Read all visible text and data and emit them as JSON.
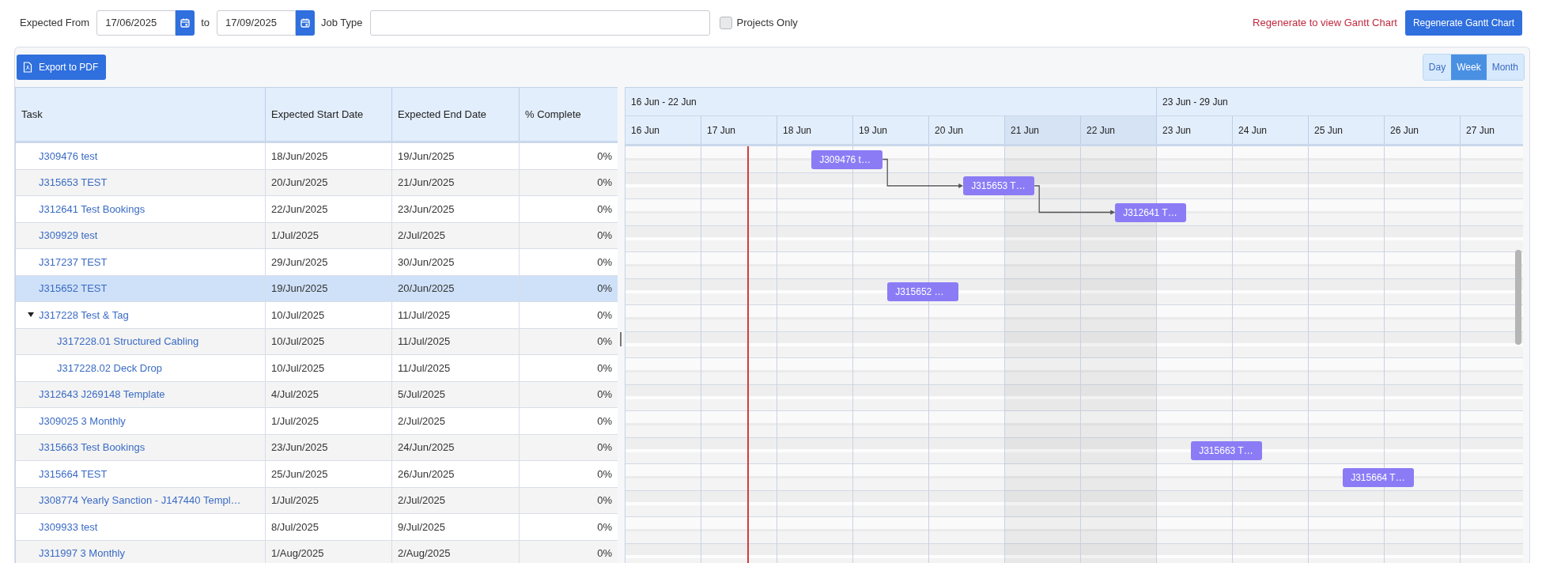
{
  "filters": {
    "expected_from": {
      "label": "Expected From",
      "value": "17/06/2025"
    },
    "to": {
      "label": "to",
      "value": "17/09/2025"
    },
    "job_type": {
      "label": "Job Type"
    },
    "projects_only": {
      "label": "Projects Only",
      "checked": false
    },
    "notice": "Regenerate to view Gantt Chart",
    "regenerate_button": "Regenerate Gantt Chart"
  },
  "toolbar": {
    "export_button": "Export to PDF",
    "scale_tabs": [
      {
        "label": "Day",
        "selected": false
      },
      {
        "label": "Week",
        "selected": true
      },
      {
        "label": "Month",
        "selected": false
      }
    ]
  },
  "table": {
    "columns": [
      "Task",
      "Expected Start Date",
      "Expected End Date",
      "% Complete"
    ]
  },
  "tasks": [
    {
      "name": "J309476 test",
      "start": "18/Jun/2025",
      "end": "19/Jun/2025",
      "complete": "0%",
      "selected": false,
      "bar": "J309476 t…"
    },
    {
      "name": "J315653 TEST",
      "start": "20/Jun/2025",
      "end": "21/Jun/2025",
      "complete": "0%",
      "selected": false,
      "dependency": true,
      "bar": "J315653 T…"
    },
    {
      "name": "J312641 Test Bookings",
      "start": "22/Jun/2025",
      "end": "23/Jun/2025",
      "complete": "0%",
      "selected": false,
      "dependency": true,
      "bar": "J312641 T…"
    },
    {
      "name": "J309929 test",
      "start": "1/Jul/2025",
      "end": "2/Jul/2025",
      "complete": "0%",
      "selected": false
    },
    {
      "name": "J317237 TEST",
      "start": "29/Jun/2025",
      "end": "30/Jun/2025",
      "complete": "0%",
      "selected": false
    },
    {
      "name": "J315652 TEST",
      "start": "19/Jun/2025",
      "end": "20/Jun/2025",
      "complete": "0%",
      "selected": true,
      "bar": "J315652 …"
    },
    {
      "name": "J317228 Test & Tag",
      "start": "10/Jul/2025",
      "end": "11/Jul/2025",
      "complete": "0%",
      "selected": false,
      "expanded": true,
      "children": [
        {
          "name": "J317228.01 Structured Cabling",
          "start": "10/Jul/2025",
          "end": "11/Jul/2025",
          "complete": "0%",
          "selected": false
        },
        {
          "name": "J317228.02 Deck Drop",
          "start": "10/Jul/2025",
          "end": "11/Jul/2025",
          "complete": "0%",
          "selected": false
        }
      ]
    },
    {
      "name": "J312643 J269148 Template",
      "start": "4/Jul/2025",
      "end": "5/Jul/2025",
      "complete": "0%",
      "selected": false
    },
    {
      "name": "J309025 3 Monthly",
      "start": "1/Jul/2025",
      "end": "2/Jul/2025",
      "complete": "0%",
      "selected": false
    },
    {
      "name": "J315663 Test Bookings",
      "start": "23/Jun/2025",
      "end": "24/Jun/2025",
      "complete": "0%",
      "selected": false,
      "bar": "J315663 T…"
    },
    {
      "name": "J315664 TEST",
      "start": "25/Jun/2025",
      "end": "26/Jun/2025",
      "complete": "0%",
      "selected": false,
      "bar": "J315664 T…"
    },
    {
      "name": "J308774 Yearly Sanction - J147440 Templ…",
      "start": "1/Jul/2025",
      "end": "2/Jul/2025",
      "complete": "0%",
      "selected": false
    },
    {
      "name": "J309933 test",
      "start": "8/Jul/2025",
      "end": "9/Jul/2025",
      "complete": "0%",
      "selected": false
    },
    {
      "name": "J311997 3 Monthly",
      "start": "1/Aug/2025",
      "end": "2/Aug/2025",
      "complete": "0%",
      "selected": false
    }
  ],
  "gantt": {
    "weeks": [
      {
        "label": "16 Jun - 22 Jun"
      },
      {
        "label": "23 Jun - 29 Jun"
      }
    ],
    "days": [
      {
        "label": "16 Jun",
        "weekend": false
      },
      {
        "label": "17 Jun",
        "weekend": false
      },
      {
        "label": "18 Jun",
        "weekend": false
      },
      {
        "label": "19 Jun",
        "weekend": false
      },
      {
        "label": "20 Jun",
        "weekend": false
      },
      {
        "label": "21 Jun",
        "weekend": true
      },
      {
        "label": "22 Jun",
        "weekend": true
      },
      {
        "label": "23 Jun",
        "weekend": false
      },
      {
        "label": "24 Jun",
        "weekend": false
      },
      {
        "label": "25 Jun",
        "weekend": false
      },
      {
        "label": "26 Jun",
        "weekend": false
      },
      {
        "label": "27 Jun",
        "weekend": false
      }
    ]
  }
}
